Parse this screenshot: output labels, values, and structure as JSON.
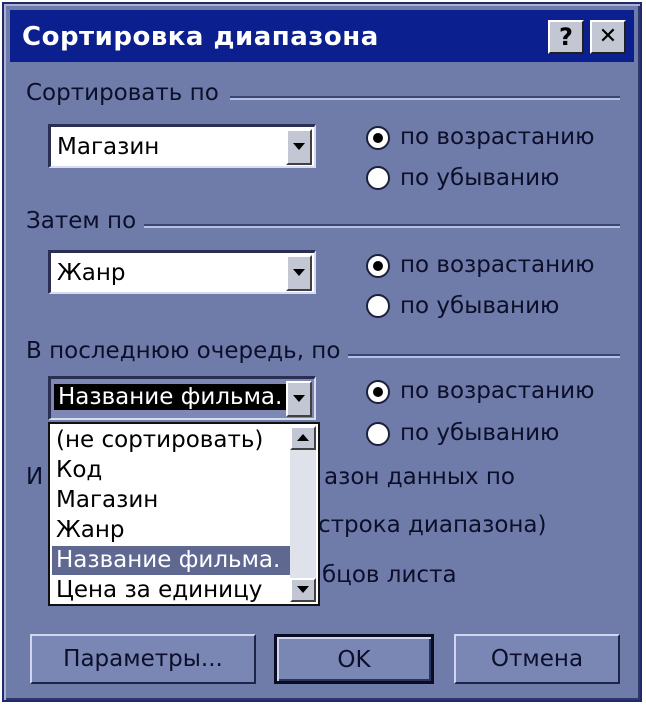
{
  "dialog": {
    "title": "Сортировка диапазона",
    "help_label": "?",
    "close_label": "✕"
  },
  "sort1": {
    "label": "Сортировать по",
    "value": "Магазин",
    "asc_label": "по возрастанию",
    "desc_label": "по убыванию",
    "selected": "asc"
  },
  "sort2": {
    "label": "Затем по",
    "value": "Жанр",
    "asc_label": "по возрастанию",
    "desc_label": "по убыванию",
    "selected": "asc"
  },
  "sort3": {
    "label": "В последнюю очередь, по",
    "value": "Название фильма.",
    "asc_label": "по возрастанию",
    "desc_label": "по убыванию",
    "selected": "asc"
  },
  "dropdown": {
    "items": [
      "(не сортировать)",
      "Код",
      "Магазин",
      "Жанр",
      "Название фильма.",
      "Цена за единицу"
    ],
    "highlighted_index": 4
  },
  "range": {
    "label_prefix": "И",
    "label_tail": "азон данных по",
    "option1_tail": "строка диапазона)",
    "option2_tail": "бцов листа"
  },
  "buttons": {
    "params": "Параметры...",
    "ok": "OK",
    "cancel": "Отмена"
  },
  "colors": {
    "dialog_bg": "#6f7ba9",
    "titlebar": "#0c1f8e",
    "highlight": "#5f6891"
  }
}
